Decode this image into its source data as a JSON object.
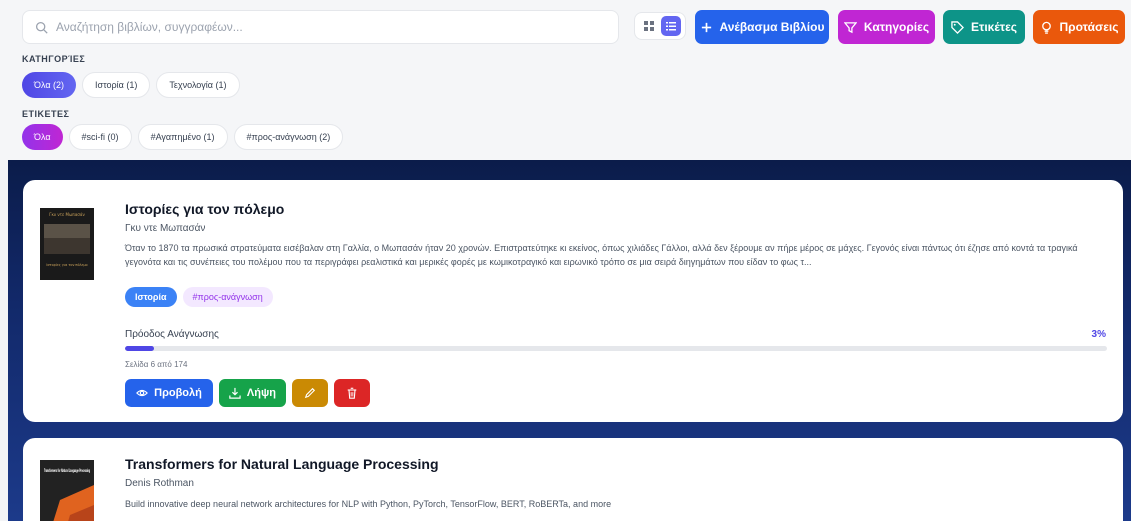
{
  "search": {
    "placeholder": "Αναζήτηση βιβλίων, συγγραφέων..."
  },
  "toolbar": {
    "upload_label": "Ανέβασμα Βιβλίου",
    "categories_label": "Κατηγορίες",
    "tags_label": "Ετικέτες",
    "suggestions_label": "Προτάσεις",
    "view_mode": "list"
  },
  "filters": {
    "categories_title": "ΚΑΤΗΓΟΡΊΕΣ",
    "categories": [
      {
        "label": "Όλα (2)",
        "active": true
      },
      {
        "label": "Ιστορία (1)",
        "active": false
      },
      {
        "label": "Τεχνολογία (1)",
        "active": false
      }
    ],
    "tags_title": "ΕΤΙΚΕΤΕΣ",
    "tags": [
      {
        "label": "Όλα",
        "active": true
      },
      {
        "label": "#sci-fi (0)",
        "active": false
      },
      {
        "label": "#Αγαπημένο (1)",
        "active": false
      },
      {
        "label": "#προς-ανάγνωση (2)",
        "active": false
      }
    ]
  },
  "books": [
    {
      "title": "Ιστορίες για τον πόλεμο",
      "author": "Γκυ ντε Μωπασάν",
      "description": "Όταν το 1870 τα πρωσικά στρατεύματα εισέβαλαν στη Γαλλία, ο Μωπασάν ήταν 20 χρονών. Επιστρατεύτηκε κι εκείνος, όπως χιλιάδες Γάλλοι, αλλά δεν ξέρουμε αν πήρε μέρος σε μάχες. Γεγονός είναι πάντως ότι έζησε από κοντά τα τραγικά γεγονότα και τις συνέπειες του πολέμου που τα περιγράφει ρεαλιστικά και μερικές φορές με κωμικοτραγικό και ειρωνικό τρόπο σε μια σειρά διηγημάτων που είδαν το φως τ...",
      "category": "Ιστορία",
      "tag": "#προς-ανάγνωση",
      "progress_label": "Πρόοδος Ανάγνωσης",
      "progress_pct": "3%",
      "progress_value": 3,
      "page_info": "Σελίδα 6 από 174",
      "cover_title": "Γκυ ντε Μωπασάν",
      "cover_subtitle": "Ιστορίες για τον πόλεμο",
      "view_label": "Προβολή",
      "download_label": "Λήψη"
    },
    {
      "title": "Transformers for Natural Language Processing",
      "author": "Denis Rothman",
      "description": "Build innovative deep neural network architectures for NLP with Python, PyTorch, TensorFlow, BERT, RoBERTa, and more",
      "cover_title": "Transformers for Natural Language Processing"
    }
  ],
  "colors": {
    "upload": "#2563eb",
    "categories": "#c026d3",
    "tags": "#0d9488",
    "suggestions": "#ea580c",
    "view": "#2563eb",
    "download": "#16a34a",
    "edit": "#ca8a04",
    "delete": "#dc2626"
  }
}
